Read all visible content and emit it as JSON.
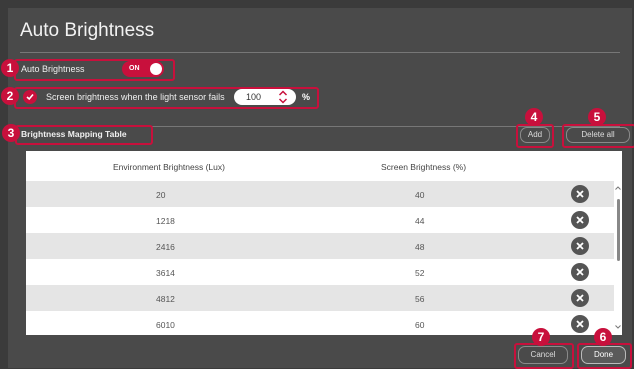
{
  "dialog": {
    "title": "Auto Brightness"
  },
  "auto_brightness": {
    "label": "Auto Brightness",
    "toggle_state": "ON"
  },
  "sensor_fail": {
    "label": "Screen brightness when the light sensor fails",
    "value": "100",
    "unit": "%"
  },
  "mapping": {
    "title": "Brightness Mapping Table",
    "add_label": "Add",
    "delete_all_label": "Delete all",
    "columns": [
      "Environment Brightness (Lux)",
      "Screen Brightness (%)"
    ],
    "rows": [
      {
        "lux": "20",
        "screen": "40"
      },
      {
        "lux": "1218",
        "screen": "44"
      },
      {
        "lux": "2416",
        "screen": "48"
      },
      {
        "lux": "3614",
        "screen": "52"
      },
      {
        "lux": "4812",
        "screen": "56"
      },
      {
        "lux": "6010",
        "screen": "60"
      }
    ]
  },
  "footer": {
    "cancel_label": "Cancel",
    "done_label": "Done"
  },
  "markers": [
    "1",
    "2",
    "3",
    "4",
    "5",
    "6",
    "7"
  ],
  "colors": {
    "accent": "#c8103c",
    "background": "#4a4a4a"
  },
  "icons": [
    "checkmark-icon",
    "spinner-arrows-icon",
    "delete-x-icon",
    "scroll-up-icon",
    "scroll-down-icon"
  ]
}
